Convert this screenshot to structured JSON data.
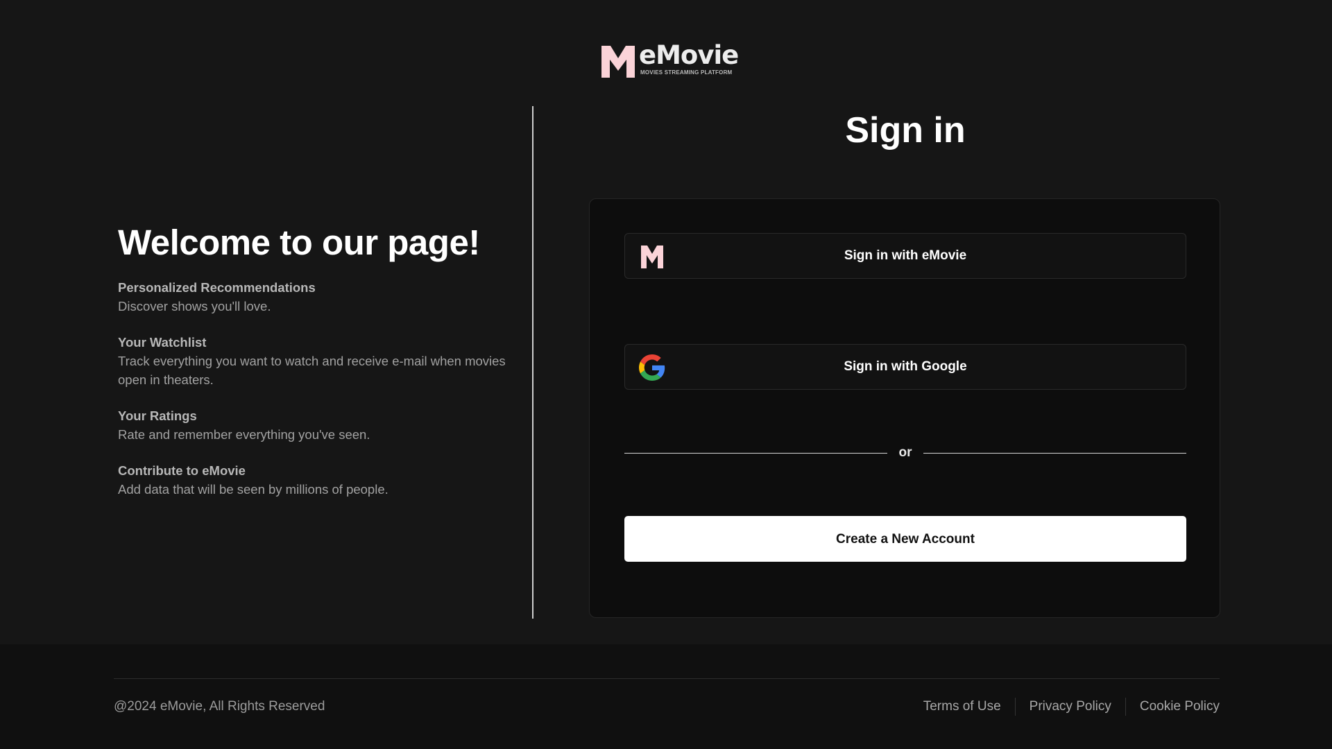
{
  "logo": {
    "wordmark": "eMovie",
    "tagline": "MOVIES STREAMING PLATFORM",
    "icon": "emovie-m-logo"
  },
  "welcome": {
    "heading": "Welcome to our page!",
    "features": [
      {
        "title": "Personalized Recommendations",
        "description": "Discover shows you'll love."
      },
      {
        "title": "Your Watchlist",
        "description": "Track everything you want to watch and receive e-mail when movies open in theaters."
      },
      {
        "title": "Your Ratings",
        "description": "Rate and remember everything you've seen."
      },
      {
        "title": "Contribute to eMovie",
        "description": "Add data that will be seen by millions of people."
      }
    ]
  },
  "signin": {
    "title": "Sign in",
    "emovie_button": {
      "label": "Sign in with eMovie",
      "icon": "emovie-m-icon"
    },
    "google_button": {
      "label": "Sign in with Google",
      "icon": "google-g-icon"
    },
    "separator": "or",
    "create_account_label": "Create a New Account"
  },
  "footer": {
    "copyright": "@2024 eMovie, All Rights Reserved",
    "links": [
      "Terms of Use",
      "Privacy Policy",
      "Cookie Policy"
    ]
  },
  "colors": {
    "background": "#161616",
    "card": "#0d0d0d",
    "footer": "#101010",
    "logo_accent": "#fbd3d8",
    "primary_button": "#ffffff"
  }
}
